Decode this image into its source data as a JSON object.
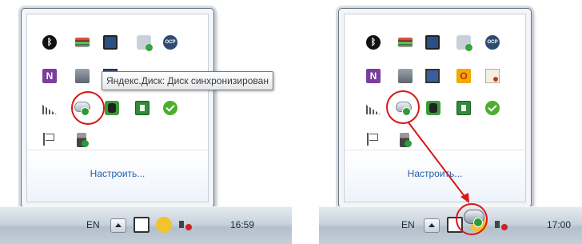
{
  "left_panel": {
    "tooltip": "Яндекс.Диск: Диск синхронизирован",
    "customize_link": "Настроить...",
    "taskbar": {
      "lang": "EN",
      "clock": "16:59"
    }
  },
  "right_panel": {
    "customize_link": "Настроить...",
    "taskbar": {
      "lang": "EN",
      "clock": "17:00"
    }
  },
  "icons": {
    "row1": [
      "bluetooth-icon",
      "network-adapter-icon",
      "display-icon",
      "sync-folder-icon",
      "ocp-icon"
    ],
    "row2": [
      "onenote-icon",
      "printer-icon",
      "laptop-icon",
      "office-icon",
      "certificate-icon"
    ],
    "row3": [
      "signal-icon",
      "yandex-disk-icon",
      "evernote-icon",
      "kaspersky-icon",
      "green-check-icon"
    ],
    "row4": [
      "action-center-flag-icon",
      "usb-safely-remove-icon"
    ]
  },
  "colors": {
    "highlight_red": "#d81818",
    "link_blue": "#1e5dad",
    "sync_green": "#2e9b39"
  }
}
